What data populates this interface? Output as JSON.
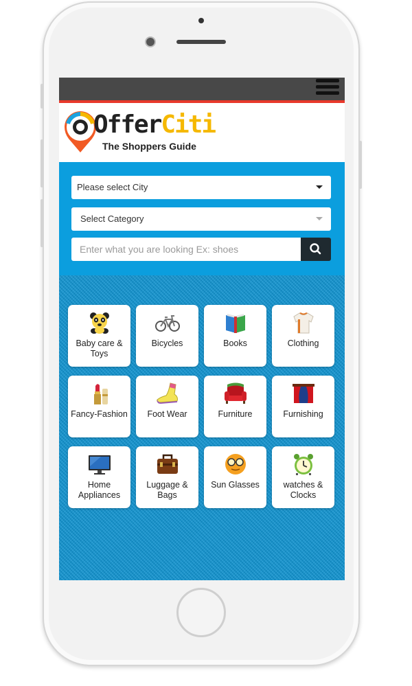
{
  "brand": {
    "name_first": "Offer",
    "name_second": "Citi",
    "tagline": "The Shoppers Guide",
    "colors": {
      "topbar": "#484848",
      "accent_line": "#e8392b",
      "panel": "#0b9ede",
      "logo_yellow": "#f5b800",
      "pin_orange": "#f15a24"
    }
  },
  "header": {
    "menu_icon": "hamburger-menu-icon"
  },
  "search": {
    "city_select": "Please select City",
    "category_select": "Select Category",
    "query_placeholder": "Enter what you are looking Ex: shoes",
    "search_icon": "search-icon"
  },
  "categories": [
    {
      "label": "Baby care & Toys",
      "icon": "teddy-bear-icon"
    },
    {
      "label": "Bicycles",
      "icon": "bicycle-icon"
    },
    {
      "label": "Books",
      "icon": "book-icon"
    },
    {
      "label": "Clothing",
      "icon": "shirt-icon"
    },
    {
      "label": "Fancy-Fashion",
      "icon": "lipstick-icon"
    },
    {
      "label": "Foot Wear",
      "icon": "shoe-icon"
    },
    {
      "label": "Furniture",
      "icon": "sofa-icon"
    },
    {
      "label": "Furnishing",
      "icon": "curtain-icon"
    },
    {
      "label": "Home Appliances",
      "icon": "monitor-icon"
    },
    {
      "label": "Luggage & Bags",
      "icon": "briefcase-icon"
    },
    {
      "label": "Sun Glasses",
      "icon": "glasses-face-icon"
    },
    {
      "label": "watches & Clocks",
      "icon": "alarm-clock-icon"
    }
  ]
}
